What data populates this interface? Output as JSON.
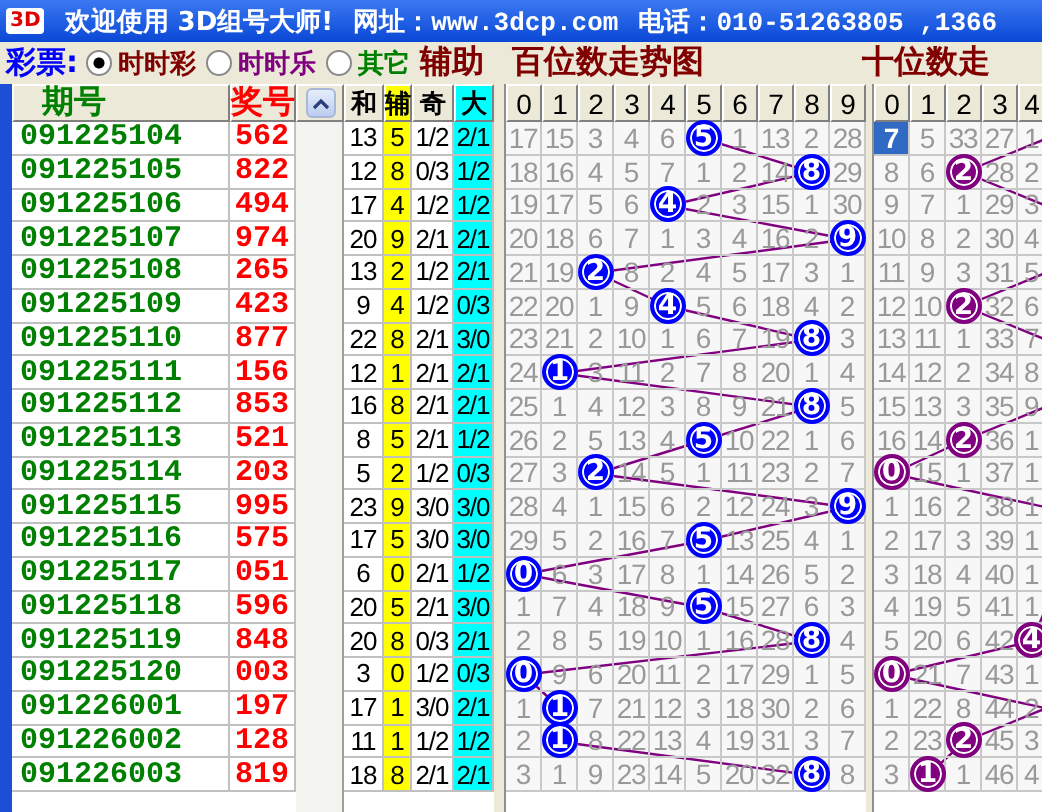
{
  "title_bar": {
    "logo": "3D",
    "welcome": "欢迎使用 3D组号大师!",
    "website": "网址：www.3dcp.com",
    "phone": "电话：010-51263805 ,1366"
  },
  "lottery": {
    "label": "彩票:",
    "options": [
      {
        "label": "时时彩",
        "selected": true,
        "color": "#800000"
      },
      {
        "label": "时时乐",
        "selected": false,
        "color": "#800080"
      },
      {
        "label": "其它",
        "selected": false,
        "color": "#008000"
      }
    ]
  },
  "aux_title": "辅助",
  "hundreds_title": "百位数走势图",
  "tens_title": "十位数走",
  "columns": {
    "issue": "期号",
    "number": "奖号",
    "sum": "和",
    "aux": "辅",
    "odd": "奇",
    "big": "大"
  },
  "rows": [
    {
      "issue": "091225104",
      "number": "562",
      "sum": "13",
      "aux": "5",
      "odd": "1/2",
      "big": "2/1"
    },
    {
      "issue": "091225105",
      "number": "822",
      "sum": "12",
      "aux": "8",
      "odd": "0/3",
      "big": "1/2"
    },
    {
      "issue": "091225106",
      "number": "494",
      "sum": "17",
      "aux": "4",
      "odd": "1/2",
      "big": "1/2"
    },
    {
      "issue": "091225107",
      "number": "974",
      "sum": "20",
      "aux": "9",
      "odd": "2/1",
      "big": "2/1"
    },
    {
      "issue": "091225108",
      "number": "265",
      "sum": "13",
      "aux": "2",
      "odd": "1/2",
      "big": "2/1"
    },
    {
      "issue": "091225109",
      "number": "423",
      "sum": "9",
      "aux": "4",
      "odd": "1/2",
      "big": "0/3"
    },
    {
      "issue": "091225110",
      "number": "877",
      "sum": "22",
      "aux": "8",
      "odd": "2/1",
      "big": "3/0"
    },
    {
      "issue": "091225111",
      "number": "156",
      "sum": "12",
      "aux": "1",
      "odd": "2/1",
      "big": "2/1"
    },
    {
      "issue": "091225112",
      "number": "853",
      "sum": "16",
      "aux": "8",
      "odd": "2/1",
      "big": "2/1"
    },
    {
      "issue": "091225113",
      "number": "521",
      "sum": "8",
      "aux": "5",
      "odd": "2/1",
      "big": "1/2"
    },
    {
      "issue": "091225114",
      "number": "203",
      "sum": "5",
      "aux": "2",
      "odd": "1/2",
      "big": "0/3"
    },
    {
      "issue": "091225115",
      "number": "995",
      "sum": "23",
      "aux": "9",
      "odd": "3/0",
      "big": "3/0"
    },
    {
      "issue": "091225116",
      "number": "575",
      "sum": "17",
      "aux": "5",
      "odd": "3/0",
      "big": "3/0"
    },
    {
      "issue": "091225117",
      "number": "051",
      "sum": "6",
      "aux": "0",
      "odd": "2/1",
      "big": "1/2"
    },
    {
      "issue": "091225118",
      "number": "596",
      "sum": "20",
      "aux": "5",
      "odd": "2/1",
      "big": "3/0"
    },
    {
      "issue": "091225119",
      "number": "848",
      "sum": "20",
      "aux": "8",
      "odd": "0/3",
      "big": "2/1"
    },
    {
      "issue": "091225120",
      "number": "003",
      "sum": "3",
      "aux": "0",
      "odd": "1/2",
      "big": "0/3"
    },
    {
      "issue": "091226001",
      "number": "197",
      "sum": "17",
      "aux": "1",
      "odd": "3/0",
      "big": "2/1"
    },
    {
      "issue": "091226002",
      "number": "128",
      "sum": "11",
      "aux": "1",
      "odd": "1/2",
      "big": "1/2"
    },
    {
      "issue": "091226003",
      "number": "819",
      "sum": "18",
      "aux": "8",
      "odd": "2/1",
      "big": "2/1"
    }
  ],
  "hundreds_chart": {
    "headers": [
      "0",
      "1",
      "2",
      "3",
      "4",
      "5",
      "6",
      "7",
      "8",
      "9"
    ],
    "rows": [
      {
        "cells": [
          {
            "text": "17",
            "hit": false
          },
          {
            "text": "15",
            "hit": false
          },
          {
            "text": "3",
            "hit": false
          },
          {
            "text": "4",
            "hit": false
          },
          {
            "text": "6",
            "hit": false
          },
          {
            "text": "5",
            "hit": true
          },
          {
            "text": "1",
            "hit": false
          },
          {
            "text": "13",
            "hit": false
          },
          {
            "text": "2",
            "hit": false
          },
          {
            "text": "28",
            "hit": false
          }
        ]
      },
      {
        "cells": [
          {
            "text": "18",
            "hit": false
          },
          {
            "text": "16",
            "hit": false
          },
          {
            "text": "4",
            "hit": false
          },
          {
            "text": "5",
            "hit": false
          },
          {
            "text": "7",
            "hit": false
          },
          {
            "text": "1",
            "hit": false
          },
          {
            "text": "2",
            "hit": false
          },
          {
            "text": "14",
            "hit": false
          },
          {
            "text": "8",
            "hit": true
          },
          {
            "text": "29",
            "hit": false
          }
        ]
      },
      {
        "cells": [
          {
            "text": "19",
            "hit": false
          },
          {
            "text": "17",
            "hit": false
          },
          {
            "text": "5",
            "hit": false
          },
          {
            "text": "6",
            "hit": false
          },
          {
            "text": "4",
            "hit": true
          },
          {
            "text": "2",
            "hit": false
          },
          {
            "text": "3",
            "hit": false
          },
          {
            "text": "15",
            "hit": false
          },
          {
            "text": "1",
            "hit": false
          },
          {
            "text": "30",
            "hit": false
          }
        ]
      },
      {
        "cells": [
          {
            "text": "20",
            "hit": false
          },
          {
            "text": "18",
            "hit": false
          },
          {
            "text": "6",
            "hit": false
          },
          {
            "text": "7",
            "hit": false
          },
          {
            "text": "1",
            "hit": false
          },
          {
            "text": "3",
            "hit": false
          },
          {
            "text": "4",
            "hit": false
          },
          {
            "text": "16",
            "hit": false
          },
          {
            "text": "2",
            "hit": false
          },
          {
            "text": "9",
            "hit": true
          }
        ]
      },
      {
        "cells": [
          {
            "text": "21",
            "hit": false
          },
          {
            "text": "19",
            "hit": false
          },
          {
            "text": "2",
            "hit": true
          },
          {
            "text": "8",
            "hit": false
          },
          {
            "text": "2",
            "hit": false
          },
          {
            "text": "4",
            "hit": false
          },
          {
            "text": "5",
            "hit": false
          },
          {
            "text": "17",
            "hit": false
          },
          {
            "text": "3",
            "hit": false
          },
          {
            "text": "1",
            "hit": false
          }
        ]
      },
      {
        "cells": [
          {
            "text": "22",
            "hit": false
          },
          {
            "text": "20",
            "hit": false
          },
          {
            "text": "1",
            "hit": false
          },
          {
            "text": "9",
            "hit": false
          },
          {
            "text": "4",
            "hit": true
          },
          {
            "text": "5",
            "hit": false
          },
          {
            "text": "6",
            "hit": false
          },
          {
            "text": "18",
            "hit": false
          },
          {
            "text": "4",
            "hit": false
          },
          {
            "text": "2",
            "hit": false
          }
        ]
      },
      {
        "cells": [
          {
            "text": "23",
            "hit": false
          },
          {
            "text": "21",
            "hit": false
          },
          {
            "text": "2",
            "hit": false
          },
          {
            "text": "10",
            "hit": false
          },
          {
            "text": "1",
            "hit": false
          },
          {
            "text": "6",
            "hit": false
          },
          {
            "text": "7",
            "hit": false
          },
          {
            "text": "19",
            "hit": false
          },
          {
            "text": "8",
            "hit": true
          },
          {
            "text": "3",
            "hit": false
          }
        ]
      },
      {
        "cells": [
          {
            "text": "24",
            "hit": false
          },
          {
            "text": "1",
            "hit": true
          },
          {
            "text": "3",
            "hit": false
          },
          {
            "text": "11",
            "hit": false
          },
          {
            "text": "2",
            "hit": false
          },
          {
            "text": "7",
            "hit": false
          },
          {
            "text": "8",
            "hit": false
          },
          {
            "text": "20",
            "hit": false
          },
          {
            "text": "1",
            "hit": false
          },
          {
            "text": "4",
            "hit": false
          }
        ]
      },
      {
        "cells": [
          {
            "text": "25",
            "hit": false
          },
          {
            "text": "1",
            "hit": false
          },
          {
            "text": "4",
            "hit": false
          },
          {
            "text": "12",
            "hit": false
          },
          {
            "text": "3",
            "hit": false
          },
          {
            "text": "8",
            "hit": false
          },
          {
            "text": "9",
            "hit": false
          },
          {
            "text": "21",
            "hit": false
          },
          {
            "text": "8",
            "hit": true
          },
          {
            "text": "5",
            "hit": false
          }
        ]
      },
      {
        "cells": [
          {
            "text": "26",
            "hit": false
          },
          {
            "text": "2",
            "hit": false
          },
          {
            "text": "5",
            "hit": false
          },
          {
            "text": "13",
            "hit": false
          },
          {
            "text": "4",
            "hit": false
          },
          {
            "text": "5",
            "hit": true
          },
          {
            "text": "10",
            "hit": false
          },
          {
            "text": "22",
            "hit": false
          },
          {
            "text": "1",
            "hit": false
          },
          {
            "text": "6",
            "hit": false
          }
        ]
      },
      {
        "cells": [
          {
            "text": "27",
            "hit": false
          },
          {
            "text": "3",
            "hit": false
          },
          {
            "text": "2",
            "hit": true
          },
          {
            "text": "14",
            "hit": false
          },
          {
            "text": "5",
            "hit": false
          },
          {
            "text": "1",
            "hit": false
          },
          {
            "text": "11",
            "hit": false
          },
          {
            "text": "23",
            "hit": false
          },
          {
            "text": "2",
            "hit": false
          },
          {
            "text": "7",
            "hit": false
          }
        ]
      },
      {
        "cells": [
          {
            "text": "28",
            "hit": false
          },
          {
            "text": "4",
            "hit": false
          },
          {
            "text": "1",
            "hit": false
          },
          {
            "text": "15",
            "hit": false
          },
          {
            "text": "6",
            "hit": false
          },
          {
            "text": "2",
            "hit": false
          },
          {
            "text": "12",
            "hit": false
          },
          {
            "text": "24",
            "hit": false
          },
          {
            "text": "3",
            "hit": false
          },
          {
            "text": "9",
            "hit": true
          }
        ]
      },
      {
        "cells": [
          {
            "text": "29",
            "hit": false
          },
          {
            "text": "5",
            "hit": false
          },
          {
            "text": "2",
            "hit": false
          },
          {
            "text": "16",
            "hit": false
          },
          {
            "text": "7",
            "hit": false
          },
          {
            "text": "5",
            "hit": true
          },
          {
            "text": "13",
            "hit": false
          },
          {
            "text": "25",
            "hit": false
          },
          {
            "text": "4",
            "hit": false
          },
          {
            "text": "1",
            "hit": false
          }
        ]
      },
      {
        "cells": [
          {
            "text": "0",
            "hit": true
          },
          {
            "text": "6",
            "hit": false
          },
          {
            "text": "3",
            "hit": false
          },
          {
            "text": "17",
            "hit": false
          },
          {
            "text": "8",
            "hit": false
          },
          {
            "text": "1",
            "hit": false
          },
          {
            "text": "14",
            "hit": false
          },
          {
            "text": "26",
            "hit": false
          },
          {
            "text": "5",
            "hit": false
          },
          {
            "text": "2",
            "hit": false
          }
        ]
      },
      {
        "cells": [
          {
            "text": "1",
            "hit": false
          },
          {
            "text": "7",
            "hit": false
          },
          {
            "text": "4",
            "hit": false
          },
          {
            "text": "18",
            "hit": false
          },
          {
            "text": "9",
            "hit": false
          },
          {
            "text": "5",
            "hit": true
          },
          {
            "text": "15",
            "hit": false
          },
          {
            "text": "27",
            "hit": false
          },
          {
            "text": "6",
            "hit": false
          },
          {
            "text": "3",
            "hit": false
          }
        ]
      },
      {
        "cells": [
          {
            "text": "2",
            "hit": false
          },
          {
            "text": "8",
            "hit": false
          },
          {
            "text": "5",
            "hit": false
          },
          {
            "text": "19",
            "hit": false
          },
          {
            "text": "10",
            "hit": false
          },
          {
            "text": "1",
            "hit": false
          },
          {
            "text": "16",
            "hit": false
          },
          {
            "text": "28",
            "hit": false
          },
          {
            "text": "8",
            "hit": true
          },
          {
            "text": "4",
            "hit": false
          }
        ]
      },
      {
        "cells": [
          {
            "text": "0",
            "hit": true
          },
          {
            "text": "9",
            "hit": false
          },
          {
            "text": "6",
            "hit": false
          },
          {
            "text": "20",
            "hit": false
          },
          {
            "text": "11",
            "hit": false
          },
          {
            "text": "2",
            "hit": false
          },
          {
            "text": "17",
            "hit": false
          },
          {
            "text": "29",
            "hit": false
          },
          {
            "text": "1",
            "hit": false
          },
          {
            "text": "5",
            "hit": false
          }
        ]
      },
      {
        "cells": [
          {
            "text": "1",
            "hit": false
          },
          {
            "text": "1",
            "hit": true
          },
          {
            "text": "7",
            "hit": false
          },
          {
            "text": "21",
            "hit": false
          },
          {
            "text": "12",
            "hit": false
          },
          {
            "text": "3",
            "hit": false
          },
          {
            "text": "18",
            "hit": false
          },
          {
            "text": "30",
            "hit": false
          },
          {
            "text": "2",
            "hit": false
          },
          {
            "text": "6",
            "hit": false
          }
        ]
      },
      {
        "cells": [
          {
            "text": "2",
            "hit": false
          },
          {
            "text": "1",
            "hit": true
          },
          {
            "text": "8",
            "hit": false
          },
          {
            "text": "22",
            "hit": false
          },
          {
            "text": "13",
            "hit": false
          },
          {
            "text": "4",
            "hit": false
          },
          {
            "text": "19",
            "hit": false
          },
          {
            "text": "31",
            "hit": false
          },
          {
            "text": "3",
            "hit": false
          },
          {
            "text": "7",
            "hit": false
          }
        ]
      },
      {
        "cells": [
          {
            "text": "3",
            "hit": false
          },
          {
            "text": "1",
            "hit": false
          },
          {
            "text": "9",
            "hit": false
          },
          {
            "text": "23",
            "hit": false
          },
          {
            "text": "14",
            "hit": false
          },
          {
            "text": "5",
            "hit": false
          },
          {
            "text": "20",
            "hit": false
          },
          {
            "text": "32",
            "hit": false
          },
          {
            "text": "8",
            "hit": true
          },
          {
            "text": "8",
            "hit": false
          }
        ]
      }
    ]
  },
  "tens_chart": {
    "headers": [
      "0",
      "1",
      "2",
      "3",
      "4"
    ],
    "rows": [
      {
        "cells": [
          {
            "text": "7",
            "hit": false,
            "selected": true
          },
          {
            "text": "5",
            "hit": false,
            "selected": false
          },
          {
            "text": "33",
            "hit": false,
            "selected": false
          },
          {
            "text": "27",
            "hit": false,
            "selected": false
          },
          {
            "text": "1",
            "hit": false,
            "selected": false
          }
        ]
      },
      {
        "cells": [
          {
            "text": "8",
            "hit": false,
            "selected": false
          },
          {
            "text": "6",
            "hit": false,
            "selected": false
          },
          {
            "text": "2",
            "hit": true,
            "selected": false
          },
          {
            "text": "28",
            "hit": false,
            "selected": false
          },
          {
            "text": "2",
            "hit": false,
            "selected": false
          }
        ]
      },
      {
        "cells": [
          {
            "text": "9",
            "hit": false,
            "selected": false
          },
          {
            "text": "7",
            "hit": false,
            "selected": false
          },
          {
            "text": "1",
            "hit": false,
            "selected": false
          },
          {
            "text": "29",
            "hit": false,
            "selected": false
          },
          {
            "text": "3",
            "hit": false,
            "selected": false
          }
        ]
      },
      {
        "cells": [
          {
            "text": "10",
            "hit": false,
            "selected": false
          },
          {
            "text": "8",
            "hit": false,
            "selected": false
          },
          {
            "text": "2",
            "hit": false,
            "selected": false
          },
          {
            "text": "30",
            "hit": false,
            "selected": false
          },
          {
            "text": "4",
            "hit": false,
            "selected": false
          }
        ]
      },
      {
        "cells": [
          {
            "text": "11",
            "hit": false,
            "selected": false
          },
          {
            "text": "9",
            "hit": false,
            "selected": false
          },
          {
            "text": "3",
            "hit": false,
            "selected": false
          },
          {
            "text": "31",
            "hit": false,
            "selected": false
          },
          {
            "text": "5",
            "hit": false,
            "selected": false
          }
        ]
      },
      {
        "cells": [
          {
            "text": "12",
            "hit": false,
            "selected": false
          },
          {
            "text": "10",
            "hit": false,
            "selected": false
          },
          {
            "text": "2",
            "hit": true,
            "selected": false
          },
          {
            "text": "32",
            "hit": false,
            "selected": false
          },
          {
            "text": "6",
            "hit": false,
            "selected": false
          }
        ]
      },
      {
        "cells": [
          {
            "text": "13",
            "hit": false,
            "selected": false
          },
          {
            "text": "11",
            "hit": false,
            "selected": false
          },
          {
            "text": "1",
            "hit": false,
            "selected": false
          },
          {
            "text": "33",
            "hit": false,
            "selected": false
          },
          {
            "text": "7",
            "hit": false,
            "selected": false
          }
        ]
      },
      {
        "cells": [
          {
            "text": "14",
            "hit": false,
            "selected": false
          },
          {
            "text": "12",
            "hit": false,
            "selected": false
          },
          {
            "text": "2",
            "hit": false,
            "selected": false
          },
          {
            "text": "34",
            "hit": false,
            "selected": false
          },
          {
            "text": "8",
            "hit": false,
            "selected": false
          }
        ]
      },
      {
        "cells": [
          {
            "text": "15",
            "hit": false,
            "selected": false
          },
          {
            "text": "13",
            "hit": false,
            "selected": false
          },
          {
            "text": "3",
            "hit": false,
            "selected": false
          },
          {
            "text": "35",
            "hit": false,
            "selected": false
          },
          {
            "text": "9",
            "hit": false,
            "selected": false
          }
        ]
      },
      {
        "cells": [
          {
            "text": "16",
            "hit": false,
            "selected": false
          },
          {
            "text": "14",
            "hit": false,
            "selected": false
          },
          {
            "text": "2",
            "hit": true,
            "selected": false
          },
          {
            "text": "36",
            "hit": false,
            "selected": false
          },
          {
            "text": "1",
            "hit": false,
            "selected": false
          }
        ]
      },
      {
        "cells": [
          {
            "text": "0",
            "hit": true,
            "selected": false
          },
          {
            "text": "15",
            "hit": false,
            "selected": false
          },
          {
            "text": "1",
            "hit": false,
            "selected": false
          },
          {
            "text": "37",
            "hit": false,
            "selected": false
          },
          {
            "text": "1",
            "hit": false,
            "selected": false
          }
        ]
      },
      {
        "cells": [
          {
            "text": "1",
            "hit": false,
            "selected": false
          },
          {
            "text": "16",
            "hit": false,
            "selected": false
          },
          {
            "text": "2",
            "hit": false,
            "selected": false
          },
          {
            "text": "38",
            "hit": false,
            "selected": false
          },
          {
            "text": "1",
            "hit": false,
            "selected": false
          }
        ]
      },
      {
        "cells": [
          {
            "text": "2",
            "hit": false,
            "selected": false
          },
          {
            "text": "17",
            "hit": false,
            "selected": false
          },
          {
            "text": "3",
            "hit": false,
            "selected": false
          },
          {
            "text": "39",
            "hit": false,
            "selected": false
          },
          {
            "text": "1",
            "hit": false,
            "selected": false
          }
        ]
      },
      {
        "cells": [
          {
            "text": "3",
            "hit": false,
            "selected": false
          },
          {
            "text": "18",
            "hit": false,
            "selected": false
          },
          {
            "text": "4",
            "hit": false,
            "selected": false
          },
          {
            "text": "40",
            "hit": false,
            "selected": false
          },
          {
            "text": "1",
            "hit": false,
            "selected": false
          }
        ]
      },
      {
        "cells": [
          {
            "text": "4",
            "hit": false,
            "selected": false
          },
          {
            "text": "19",
            "hit": false,
            "selected": false
          },
          {
            "text": "5",
            "hit": false,
            "selected": false
          },
          {
            "text": "41",
            "hit": false,
            "selected": false
          },
          {
            "text": "1",
            "hit": false,
            "selected": false
          }
        ]
      },
      {
        "cells": [
          {
            "text": "5",
            "hit": false,
            "selected": false
          },
          {
            "text": "20",
            "hit": false,
            "selected": false
          },
          {
            "text": "6",
            "hit": false,
            "selected": false
          },
          {
            "text": "42",
            "hit": false,
            "selected": false
          },
          {
            "text": "4",
            "hit": true,
            "selected": false
          }
        ]
      },
      {
        "cells": [
          {
            "text": "0",
            "hit": true,
            "selected": false
          },
          {
            "text": "21",
            "hit": false,
            "selected": false
          },
          {
            "text": "7",
            "hit": false,
            "selected": false
          },
          {
            "text": "43",
            "hit": false,
            "selected": false
          },
          {
            "text": "1",
            "hit": false,
            "selected": false
          }
        ]
      },
      {
        "cells": [
          {
            "text": "1",
            "hit": false,
            "selected": false
          },
          {
            "text": "22",
            "hit": false,
            "selected": false
          },
          {
            "text": "8",
            "hit": false,
            "selected": false
          },
          {
            "text": "44",
            "hit": false,
            "selected": false
          },
          {
            "text": "2",
            "hit": false,
            "selected": false
          }
        ]
      },
      {
        "cells": [
          {
            "text": "2",
            "hit": false,
            "selected": false
          },
          {
            "text": "23",
            "hit": false,
            "selected": false
          },
          {
            "text": "2",
            "hit": true,
            "selected": false
          },
          {
            "text": "45",
            "hit": false,
            "selected": false
          },
          {
            "text": "3",
            "hit": false,
            "selected": false
          }
        ]
      },
      {
        "cells": [
          {
            "text": "3",
            "hit": false,
            "selected": false
          },
          {
            "text": "1",
            "hit": true,
            "selected": false
          },
          {
            "text": "1",
            "hit": false,
            "selected": false
          },
          {
            "text": "46",
            "hit": false,
            "selected": false
          },
          {
            "text": "4",
            "hit": false,
            "selected": false
          }
        ]
      }
    ]
  }
}
